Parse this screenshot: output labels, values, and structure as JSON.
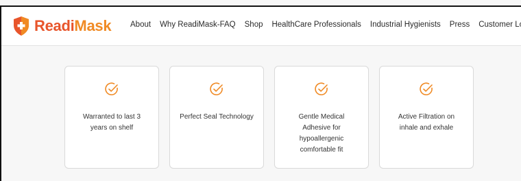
{
  "brand": {
    "name_part1": "Readi",
    "name_part2": "Mask",
    "primary_color": "#e8552b",
    "accent_color": "#f08a24",
    "logo_icon": "shield-plus-icon"
  },
  "nav": {
    "items": [
      "About",
      "Why ReadiMask-FAQ",
      "Shop",
      "HealthCare Professionals",
      "Industrial Hygienists",
      "Press",
      "Customer Logi"
    ]
  },
  "features": [
    {
      "icon": "check-circle-icon",
      "text": "Warranted to last 3 years on shelf"
    },
    {
      "icon": "check-circle-icon",
      "text": "Perfect Seal Technology"
    },
    {
      "icon": "check-circle-icon",
      "text": "Gentle Medical Adhesive for hypoallergenic comfortable fit"
    },
    {
      "icon": "check-circle-icon",
      "text": "Active Filtration on inhale and exhale"
    }
  ]
}
